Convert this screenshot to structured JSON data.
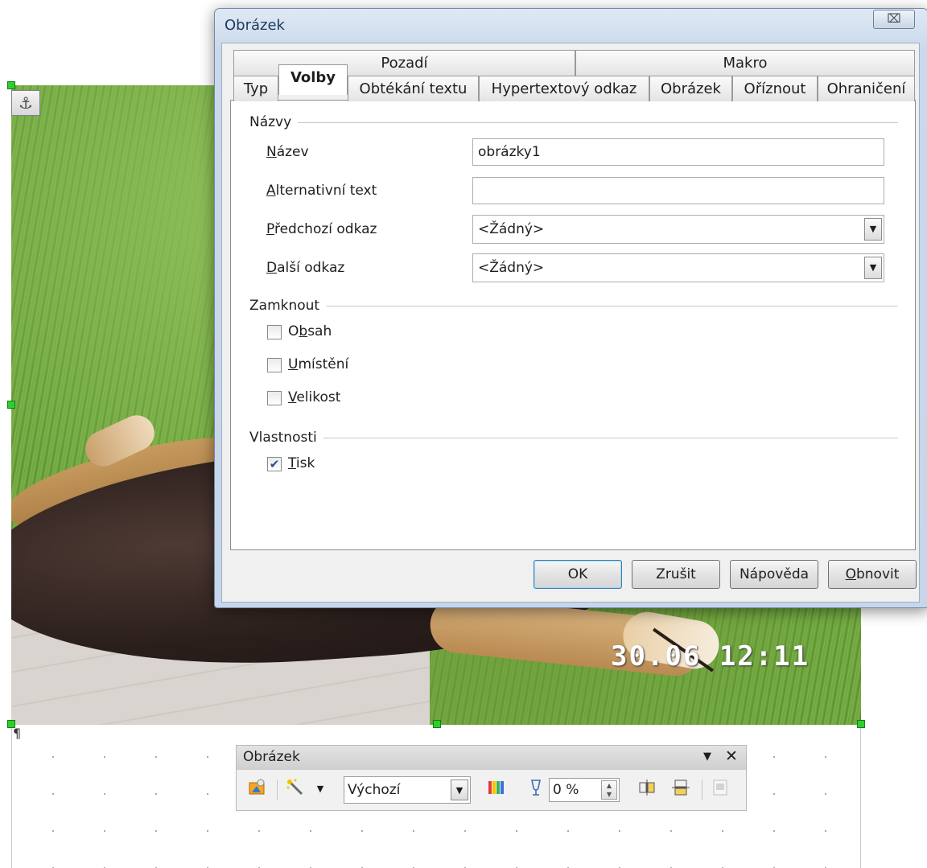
{
  "photo": {
    "timestamp": "30.06 12:11"
  },
  "document": {
    "anchor_icon": "anchor-icon",
    "paragraph_mark": "¶"
  },
  "dialog": {
    "title": "Obrázek",
    "close_glyph": "⌧",
    "tabs_row_top": [
      {
        "label": "Pozadí"
      },
      {
        "label": "Makro"
      }
    ],
    "tabs_row_bottom": [
      {
        "label": "Typ"
      },
      {
        "label": "Volby",
        "active": true
      },
      {
        "label": "Obtékání textu"
      },
      {
        "label": "Hypertextový odkaz"
      },
      {
        "label": "Obrázek"
      },
      {
        "label": "Oříznout"
      },
      {
        "label": "Ohraničení"
      }
    ],
    "names_group": {
      "label": "Názvy",
      "name_label_u": "N",
      "name_label_rest": "ázev",
      "name_value": "obrázky1",
      "alt_label_u": "A",
      "alt_label_rest": "lternativní text",
      "alt_value": "",
      "prev_label_u": "P",
      "prev_label_rest": "ředchozí odkaz",
      "prev_value": "<Žádný>",
      "next_label_u": "D",
      "next_label_rest": "alší odkaz",
      "next_value": "<Žádný>"
    },
    "lock_group": {
      "label": "Zamknout",
      "items": [
        {
          "pre": "O",
          "u": "b",
          "post": "sah",
          "checked": false
        },
        {
          "pre": "",
          "u": "U",
          "post": "místění",
          "checked": false
        },
        {
          "pre": "",
          "u": "V",
          "post": "elikost",
          "checked": false
        }
      ]
    },
    "props_group": {
      "label": "Vlastnosti",
      "print_u": "T",
      "print_rest": "isk",
      "print_checked": true
    },
    "buttons": {
      "ok": "OK",
      "cancel": "Zrušit",
      "help": "Nápověda",
      "reset_u": "O",
      "reset_rest": "bnovit"
    }
  },
  "toolbar": {
    "title": "Obrázek",
    "menu_glyph": "▼",
    "close_glyph": "✕",
    "filter_value": "Výchozí",
    "transparency_value": "0 %",
    "icons": [
      "image-graphic-icon",
      "filter-wand-icon",
      "color-bars-icon",
      "transparency-icon",
      "flip-vertical-icon",
      "flip-horizontal-icon",
      "image-properties-icon"
    ]
  }
}
